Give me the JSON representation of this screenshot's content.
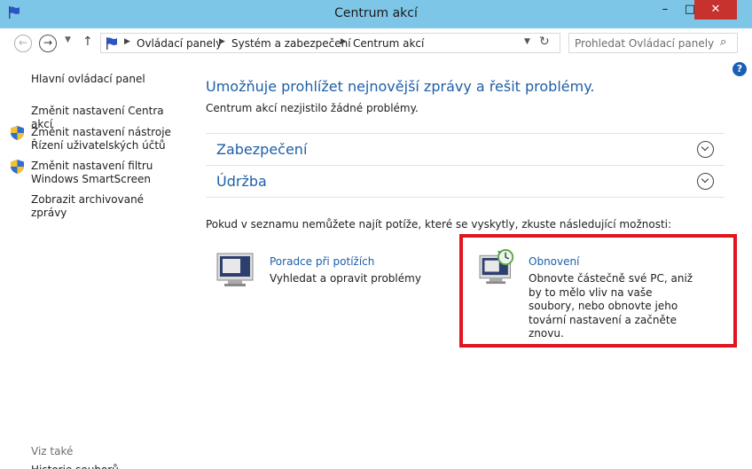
{
  "window": {
    "title": "Centrum akcí",
    "minimize_label": "–",
    "maximize_label": "□",
    "close_label": "✕"
  },
  "address": {
    "breadcrumbs": [
      "Ovládací panely",
      "Systém a zabezpečení",
      "Centrum akcí"
    ],
    "search_placeholder": "Prohledat Ovládací panely"
  },
  "sidebar": {
    "items": [
      {
        "label": "Hlavní ovládací panel",
        "shield": false
      },
      {
        "label": "Změnit nastavení Centra akcí",
        "shield": false
      },
      {
        "label": "Změnit nastavení nástroje Řízení uživatelských účtů",
        "shield": true
      },
      {
        "label": "Změnit nastavení filtru Windows SmartScreen",
        "shield": true
      },
      {
        "label": "Zobrazit archivované zprávy",
        "shield": false
      }
    ],
    "see_also": "Viz také",
    "cut_item": "Historie souborů"
  },
  "main": {
    "title": "Umožňuje prohlížet nejnovější zprávy a řešit problémy.",
    "subtitle": "Centrum akcí nezjistilo žádné problémy.",
    "sections": [
      "Zabezpečení",
      "Údržba"
    ],
    "hint": "Pokud v seznamu nemůžete najít potíže, které se vyskytly, zkuste následující možnosti:",
    "tools": [
      {
        "link": "Poradce při potížích",
        "description": "Vyhledat a opravit problémy"
      },
      {
        "link": "Obnovení",
        "description": "Obnovte částečně své PC, aniž by to mělo vliv na vaše soubory, nebo obnovte jeho tovární nastavení a začněte znovu."
      }
    ]
  },
  "colors": {
    "titlebar": "#7dc6e8",
    "link": "#1e5fa8",
    "close": "#c7312e",
    "highlight": "#e0151e"
  }
}
